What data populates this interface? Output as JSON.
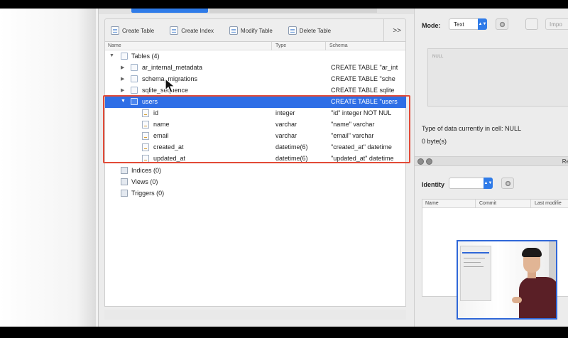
{
  "toolbar": {
    "create_table": "Create Table",
    "create_index": "Create Index",
    "modify_table": "Modify Table",
    "delete_table": "Delete Table",
    "more": ">>"
  },
  "tree": {
    "columns": {
      "name": "Name",
      "type": "Type",
      "schema": "Schema"
    },
    "tables_label": "Tables (4)",
    "tables": [
      {
        "name": "ar_internal_metadata",
        "schema": "CREATE TABLE \"ar_int"
      },
      {
        "name": "schema_migrations",
        "schema": "CREATE TABLE \"sche"
      },
      {
        "name": "sqlite_sequence",
        "schema": "CREATE TABLE sqlite"
      },
      {
        "name": "users",
        "schema": "CREATE TABLE \"users"
      }
    ],
    "fields": [
      {
        "name": "id",
        "type": "integer",
        "schema": "\"id\" integer NOT NUL"
      },
      {
        "name": "name",
        "type": "varchar",
        "schema": "\"name\" varchar"
      },
      {
        "name": "email",
        "type": "varchar",
        "schema": "\"email\" varchar"
      },
      {
        "name": "created_at",
        "type": "datetime(6)",
        "schema": "\"created_at\" datetime"
      },
      {
        "name": "updated_at",
        "type": "datetime(6)",
        "schema": "\"updated_at\" datetime"
      }
    ],
    "indices_label": "Indices (0)",
    "views_label": "Views (0)",
    "triggers_label": "Triggers (0)"
  },
  "edit_cell": {
    "mode_label": "Mode:",
    "mode_value": "Text",
    "import_label": "Impo",
    "cell_value": "NULL",
    "type_text": "Type of data currently in cell: NULL",
    "size_text": "0 byte(s)"
  },
  "remote": {
    "section_cut_label": "Re",
    "identity_label": "Identity",
    "columns": {
      "name": "Name",
      "commit": "Commit",
      "last_modified": "Last modifie"
    }
  }
}
